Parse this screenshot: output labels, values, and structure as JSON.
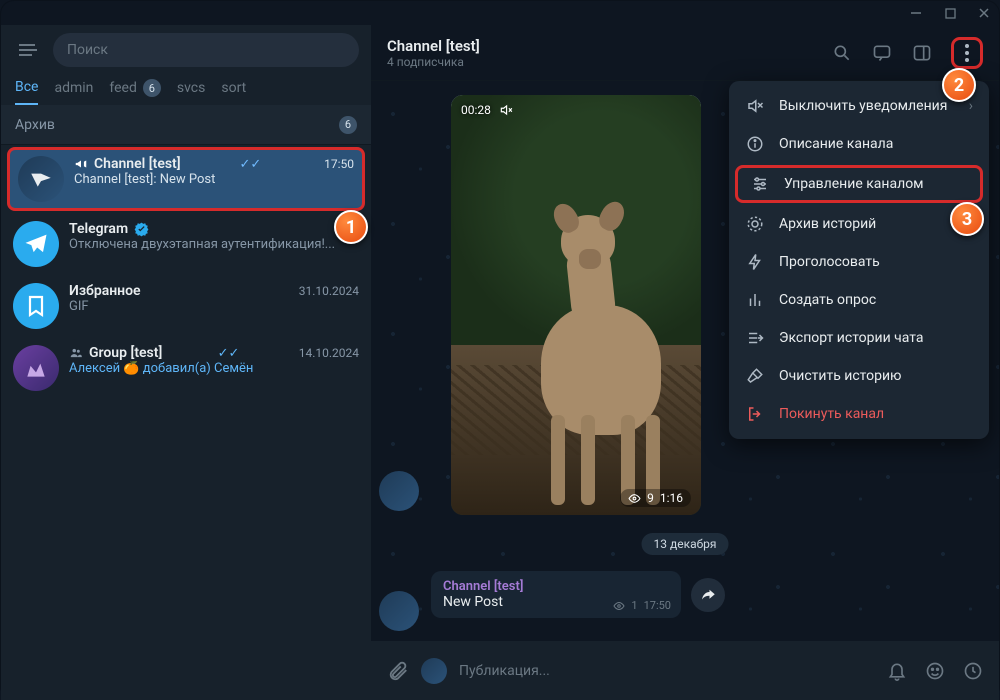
{
  "window": {
    "title": ""
  },
  "sidebar": {
    "search_placeholder": "Поиск",
    "tabs": [
      {
        "label": "Все",
        "active": true
      },
      {
        "label": "admin"
      },
      {
        "label": "feed",
        "badge": "6"
      },
      {
        "label": "svcs"
      },
      {
        "label": "sort"
      }
    ],
    "archive": {
      "label": "Архив",
      "badge": "6"
    },
    "chats": [
      {
        "name": "Channel [test]",
        "icon": "megaphone",
        "time": "17:50",
        "ticks": true,
        "preview": "Channel [test]: New Post",
        "selected": true
      },
      {
        "name": "Telegram",
        "verified": true,
        "preview": "Отключена двухэтапная аутентификация!..."
      },
      {
        "name": "Избранное",
        "time": "31.10.2024",
        "preview": "GIF"
      },
      {
        "name": "Group [test]",
        "icon": "group",
        "time": "14.10.2024",
        "ticks": true,
        "preview": "Алексей 🍊 добавил(а) Семён",
        "preview_color": "#5eb5f7"
      }
    ]
  },
  "header": {
    "title": "Channel [test]",
    "subtitle": "4 подписчика"
  },
  "menu": {
    "items": [
      {
        "icon": "mute",
        "label": "Выключить уведомления",
        "chevron": true
      },
      {
        "icon": "info",
        "label": "Описание канала"
      },
      {
        "icon": "sliders",
        "label": "Управление каналом",
        "highlight": true
      },
      {
        "icon": "archive",
        "label": "Архив историй"
      },
      {
        "icon": "bolt",
        "label": "Проголосовать"
      },
      {
        "icon": "poll",
        "label": "Создать опрос"
      },
      {
        "icon": "export",
        "label": "Экспорт истории чата"
      },
      {
        "icon": "broom",
        "label": "Очистить историю"
      },
      {
        "icon": "leave",
        "label": "Покинуть канал",
        "danger": true
      }
    ]
  },
  "messages": {
    "video": {
      "duration": "00:28",
      "views": "9",
      "time": "1:16"
    },
    "date_chip": "13 декабря",
    "post": {
      "from": "Channel [test]",
      "body": "New Post",
      "views": "1",
      "time": "17:50"
    }
  },
  "composer": {
    "placeholder": "Публикация..."
  },
  "steps": {
    "s1": "1",
    "s2": "2",
    "s3": "3"
  }
}
